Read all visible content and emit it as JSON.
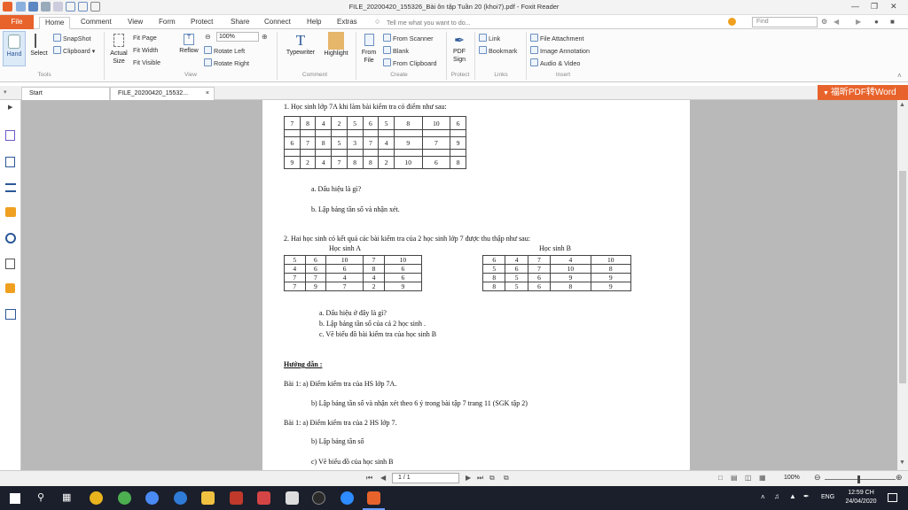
{
  "window": {
    "title": "FILE_20200420_155326_Bài ôn tập Tuần 20 (khoi7).pdf - Foxit Reader"
  },
  "menu": {
    "tabs": [
      "File",
      "Home",
      "Comment",
      "View",
      "Form",
      "Protect",
      "Share",
      "Connect",
      "Help",
      "Extras"
    ],
    "tell_me": "Tell me what you want to do...",
    "find_placeholder": "Find"
  },
  "ribbon": {
    "hand": "Hand",
    "select": "Select",
    "snapshot": "SnapShot",
    "clipboard": "Clipboard",
    "actual_size": "Actual Size",
    "fit_page": "Fit Page",
    "fit_width": "Fit Width",
    "fit_visible": "Fit Visible",
    "reflow": "Reflow",
    "zoom_value": "100%",
    "rotate_left": "Rotate Left",
    "rotate_right": "Rotate Right",
    "typewriter": "Typewriter",
    "highlight": "Highlight",
    "from_file": "From File",
    "from_scanner": "From Scanner",
    "blank": "Blank",
    "from_clipboard": "From Clipboard",
    "pdf_sign": "PDF Sign",
    "link": "Link",
    "bookmark": "Bookmark",
    "file_attachment": "File Attachment",
    "image_annotation": "Image Annotation",
    "audio_video": "Audio & Video",
    "groups": [
      "Tools",
      "View",
      "Comment",
      "Create",
      "Protect",
      "Links",
      "Insert"
    ]
  },
  "doctabs": {
    "start": "Start",
    "file": "FILE_20200420_15532..."
  },
  "promo": "福昕PDF转Word",
  "doc": {
    "q1": "1.  Học sinh lớp 7A khi làm bài kiểm tra có điểm như sau:",
    "q1_table": [
      [
        "7",
        "8",
        "4",
        "2",
        "5",
        "6",
        "5",
        "8",
        "10",
        "6"
      ],
      [
        "6",
        "7",
        "8",
        "5",
        "3",
        "7",
        "4",
        "9",
        "7",
        "9"
      ],
      [
        "9",
        "2",
        "4",
        "7",
        "8",
        "8",
        "2",
        "10",
        "6",
        "8"
      ]
    ],
    "q1a": "a. Dấu hiệu là gì?",
    "q1b": "b. Lập bảng tần số và nhận xét.",
    "q2": "2.   Hai học sinh có kết quả các bài kiểm tra của 2 học sinh lớp 7 được thu thập như sau:",
    "student_a": "Học sinh  A",
    "student_b": "Học sinh B",
    "table_a": [
      [
        "5",
        "6",
        "10",
        "7",
        "10"
      ],
      [
        "4",
        "6",
        "6",
        "8",
        "6"
      ],
      [
        "7",
        "7",
        "4",
        "4",
        "6"
      ],
      [
        "7",
        "9",
        "7",
        "2",
        "9"
      ]
    ],
    "table_b": [
      [
        "6",
        "4",
        "7",
        "4",
        "10"
      ],
      [
        "5",
        "6",
        "7",
        "10",
        "8"
      ],
      [
        "8",
        "5",
        "6",
        "9",
        "9"
      ],
      [
        "8",
        "5",
        "6",
        "8",
        "9"
      ]
    ],
    "q2a": "a.   Dấu hiệu ở đây là gì?",
    "q2b": "b.   Lập bảng tần số của cả 2 học sinh .",
    "q2c": "c.   Vẽ biểu đồ bài kiểm tra của học sinh B",
    "guide": "Hướng dẫn :",
    "g1a": "Bài 1:  a)  Điểm kiểm tra của HS lớp 7A.",
    "g1b": "b)  Lập bảng tần số và nhận xét theo 6 ý trong bài tập 7 trang 11 (SGK tập 2)",
    "g2a": "Bài 1:  a)  Điểm kiểm tra của 2 HS lớp 7.",
    "g2b": "b)  Lập bảng tần số",
    "g2c": "c)  Vẽ biểu đồ của học sinh B"
  },
  "status": {
    "page": "1 / 1",
    "zoom": "100%"
  },
  "taskbar": {
    "lang": "ENG",
    "time": "12:59 CH",
    "date": "24/04/2020"
  },
  "colors": {
    "accent": "#e8632c",
    "taskbar": "#1a1f2b"
  }
}
